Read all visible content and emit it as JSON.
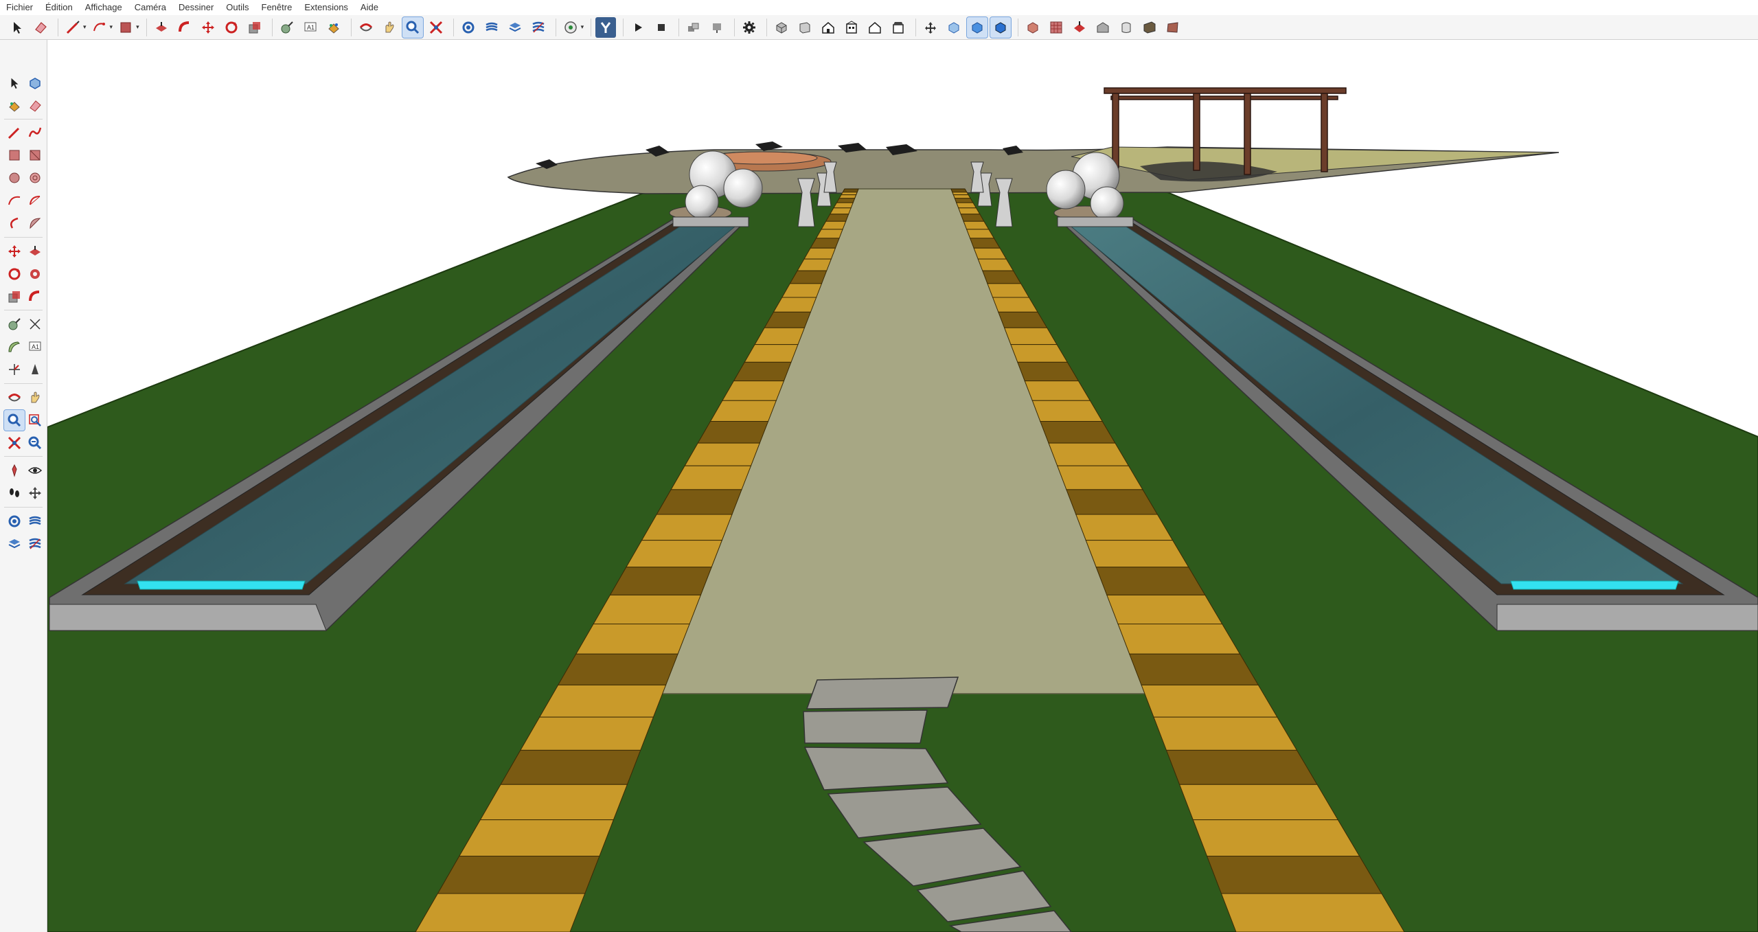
{
  "menubar": {
    "items": [
      "Fichier",
      "Édition",
      "Affichage",
      "Caméra",
      "Dessiner",
      "Outils",
      "Fenêtre",
      "Extensions",
      "Aide"
    ]
  },
  "toolbar": {
    "icons": [
      "select-icon",
      "eraser-icon",
      "line-icon",
      "arc-icon",
      "rectangle-icon",
      "pushpull-icon",
      "followme-icon",
      "move-icon",
      "rotate-icon",
      "scale-icon",
      "tape-icon",
      "text-icon",
      "paint-icon",
      "orbit-icon",
      "pan-icon",
      "zoom-icon",
      "zoom-extents-icon",
      "section-icon",
      "layers-icon",
      "tags-icon",
      "styles-icon",
      "geolocation-icon",
      "extension-y-icon",
      "play-icon",
      "stop-icon",
      "scenes-icon",
      "settings-gear-icon",
      "iso-view-icon",
      "top-view-icon",
      "front-view-icon",
      "right-view-icon",
      "back-view-icon",
      "left-view-icon",
      "xray-icon",
      "backedges-icon",
      "wireframe-icon",
      "hidden-line-icon",
      "shaded-icon",
      "textured-icon",
      "monochrome-icon",
      "warehouse-icon",
      "extension-warehouse-icon",
      "layout-icon",
      "sandbox-icon"
    ]
  },
  "lefttoolbar": {
    "icons": [
      "select-icon",
      "component-icon",
      "paint-icon",
      "eraser-icon",
      "line-icon",
      "freehand-icon",
      "rectangle-icon",
      "rotated-rectangle-icon",
      "circle-icon",
      "polygon-icon",
      "arc-icon",
      "pie-icon",
      "two-point-arc-icon",
      "three-point-arc-icon",
      "move-icon",
      "pushpull-icon",
      "rotate-icon",
      "followme-icon",
      "scale-icon",
      "offset-icon",
      "tape-icon",
      "dimension-icon",
      "protractor-icon",
      "text-icon",
      "axes-icon",
      "3d-text-icon",
      "orbit-icon",
      "pan-icon",
      "zoom-icon",
      "zoom-window-icon",
      "zoom-extents-icon",
      "previous-view-icon",
      "position-camera-icon",
      "look-around-icon",
      "walk-icon",
      "section-plane-icon",
      "section-fill-icon",
      "section-display-icon",
      "layers-icon",
      "outliner-icon"
    ]
  },
  "colors": {
    "grass": "#2e5a1c",
    "path": "#a7a784",
    "water": "#3e6f76",
    "pool-light": "#33e1f0",
    "curb": "#6f6f6f",
    "brick-light": "#c99a2a",
    "brick-dark": "#7a5a12",
    "pergola": "#6b3d2a",
    "stone": "#9b9a92"
  }
}
